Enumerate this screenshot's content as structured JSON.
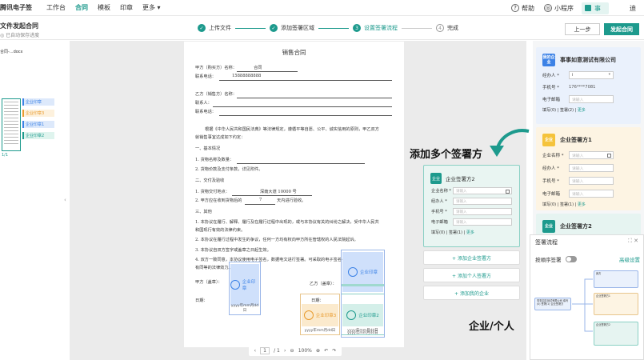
{
  "nav": {
    "brand": "腾讯电子签",
    "links": [
      "工作台",
      "合同",
      "模板",
      "印章",
      "更多"
    ],
    "active": "合同",
    "help": "帮助",
    "miniprogram": "小程序",
    "enterprise": "事",
    "user": "迪"
  },
  "subbar": {
    "title": "文件发起合同",
    "autosave": "已自动保存进度",
    "steps": [
      {
        "num": "✓",
        "label": "上传文件",
        "state": "done"
      },
      {
        "num": "✓",
        "label": "添加签署区域",
        "state": "done"
      },
      {
        "num": "3",
        "label": "设置签署流程",
        "state": "current"
      },
      {
        "num": "4",
        "label": "完成",
        "state": "todo"
      }
    ],
    "prev_button": "上一步",
    "send_button": "发起合同"
  },
  "thumbs": {
    "filename": "合同-...docx",
    "page_indicator": "1/1",
    "tags": [
      {
        "label": "企业印章",
        "color": "blue"
      },
      {
        "label": "企业印章3",
        "color": "orange"
      },
      {
        "label": "企业印章1",
        "color": "blue"
      },
      {
        "label": "企业印章2",
        "color": "green"
      }
    ]
  },
  "doc": {
    "title": "销售合同",
    "party_a_label": "甲方（购买方）名称：",
    "party_a_value": "合同",
    "contact_a_label": "联系电话：",
    "contact_a_value": "15888888888",
    "party_b_label": "乙方（销售方）名称：",
    "contact_person_label": "联系人：",
    "contact_b_label": "联系电话：",
    "intro": "根据《中华人民共和国民法典》等法律规定，遵循平等自愿、公平、诚实信用的原则，甲乙双方",
    "intro2": "就销售事宜达成如下约定：",
    "s1": "一、基本情况",
    "s1a": "1. 货物名称及数量：",
    "s1b": "2. 货物价款及支付条款，详见附件。",
    "s2": "二、交付及验收",
    "s2a": "1. 货物交付地点：",
    "s2a_value": "深南大道 10000 号",
    "s2b": "2. 甲方应在收到货物后的",
    "s2b_value": "7",
    "s2b_tail": "天内进行验收。",
    "s3": "三、其他",
    "s3a": "1. 本协议在履行、解释、履行及在履行过程中出现的，或与本协议有关的纠纷之解决，受中华人民共",
    "s3a2": "和国现行有效的法律约束。",
    "s3b": "2. 本协议在履行过程中发生的争议，任何一方均有权向甲方所在管辖权的人民法院起诉。",
    "s3c": "3. 本协议自双方签字或盖章之日起生效。",
    "s3d": "4. 双方一致同意，本协议使用电子签名，数据电文进行签署。可采取的电子签名与手写签名或者盖章具",
    "s3d2": "有同等的法律效力。",
    "party_a_sign": "甲方（盖章）：",
    "party_b_sign": "乙方（盖章）：",
    "date_label": "日期：",
    "date_label2": "日期：",
    "seal_a": "企业印章",
    "seal_main": "企业印章",
    "seal_3": "企业印章3",
    "seal_2": "企业印章2",
    "date_placeholder": "yyyy年mm月dd日"
  },
  "pagination": {
    "page": "1",
    "total": "/ 1",
    "zoom": "100%"
  },
  "callouts": {
    "add_multiple": "添加多个签署方",
    "enterprise_person": "企业/个人"
  },
  "floating_card": {
    "badge": "企业",
    "title": "企业签署方2",
    "rows": [
      {
        "label": "企业名称 *",
        "placeholder": "请输入"
      },
      {
        "label": "经办人 *",
        "placeholder": "请输入"
      },
      {
        "label": "手机号 *",
        "placeholder": "请输入"
      },
      {
        "label": "电子邮箱",
        "placeholder": "请输入"
      }
    ],
    "footer_prefix": "填写(0)  |  签署(1)  |",
    "footer_more": "更多",
    "add_enterprise": "+ 添加企业签署方",
    "add_person": "+ 添加个人签署方",
    "add_my_enterprise": "+ 添加我的企业"
  },
  "right_panel": {
    "card1": {
      "badge": "我的企业",
      "title": "事事如意测试有限公司",
      "operator_label": "经办人 *",
      "operator_value": "i",
      "phone_label": "手机号 *",
      "phone_value": "176****7081",
      "email_label": "电子邮箱",
      "email_placeholder": "请输入",
      "footer_prefix": "填写(0)  |  签署(2)  |",
      "footer_more": "更多"
    },
    "card2": {
      "badge": "企业",
      "title": "企业签署方1",
      "rows": [
        {
          "label": "企业名称 *",
          "placeholder": "请输入"
        },
        {
          "label": "经办人 *",
          "placeholder": "请输入"
        },
        {
          "label": "手机号 *",
          "placeholder": "请输入"
        },
        {
          "label": "电子邮箱",
          "placeholder": "请输入"
        }
      ],
      "footer_prefix": "填写(0)  |  签署(1)  |",
      "footer_more": "更多"
    },
    "card3": {
      "badge": "企业",
      "title": "企业签署方2"
    }
  },
  "flow": {
    "title": "签署流程",
    "order_label": "按顺序签署",
    "advanced": "高级设置",
    "icons": "⛶  ✕",
    "node_main": "事事如意测试有限公司 填写(0) 签署(1) 企业签署方",
    "node_a": "我方",
    "node_b": "企业签署方1",
    "node_c": "企业签署方2"
  },
  "colors": {
    "accent": "#1d9a8d",
    "blue": "#3c82e6",
    "orange": "#e99b2e"
  }
}
